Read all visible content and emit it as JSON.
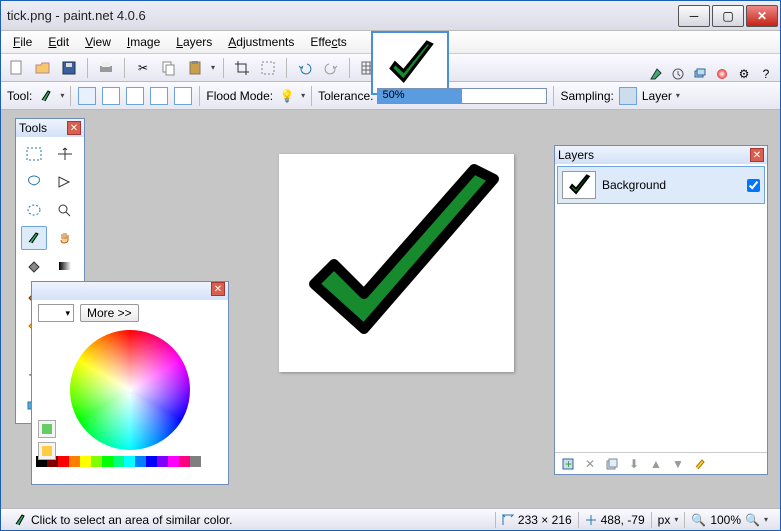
{
  "titlebar": {
    "title": "tick.png - paint.net 4.0.6"
  },
  "menubar": {
    "file": "File",
    "edit": "Edit",
    "view": "View",
    "image": "Image",
    "layers": "Layers",
    "adjustments": "Adjustments",
    "effects": "Effects"
  },
  "toolbar2": {
    "tool_label": "Tool:",
    "flood_mode_label": "Flood Mode:",
    "tolerance_label": "Tolerance:",
    "tolerance_value": "50%",
    "sampling_label": "Sampling:",
    "sampling_value": "Layer"
  },
  "tools_panel": {
    "title": "Tools"
  },
  "colors_panel": {
    "more": "More >>"
  },
  "layers_panel": {
    "title": "Layers",
    "item0": {
      "name": "Background"
    }
  },
  "statusbar": {
    "hint": "Click to select an area of similar color.",
    "dims": "233 × 216",
    "cursor": "488, -79",
    "unit": "px",
    "zoom": "100%"
  },
  "swatches": [
    "#000000",
    "#7f0000",
    "#ff0000",
    "#ff7f00",
    "#ffff00",
    "#7fff00",
    "#00ff00",
    "#00ff7f",
    "#00ffff",
    "#007fff",
    "#0000ff",
    "#7f00ff",
    "#ff00ff",
    "#ff007f",
    "#7f7f7f",
    "#ffffff"
  ]
}
